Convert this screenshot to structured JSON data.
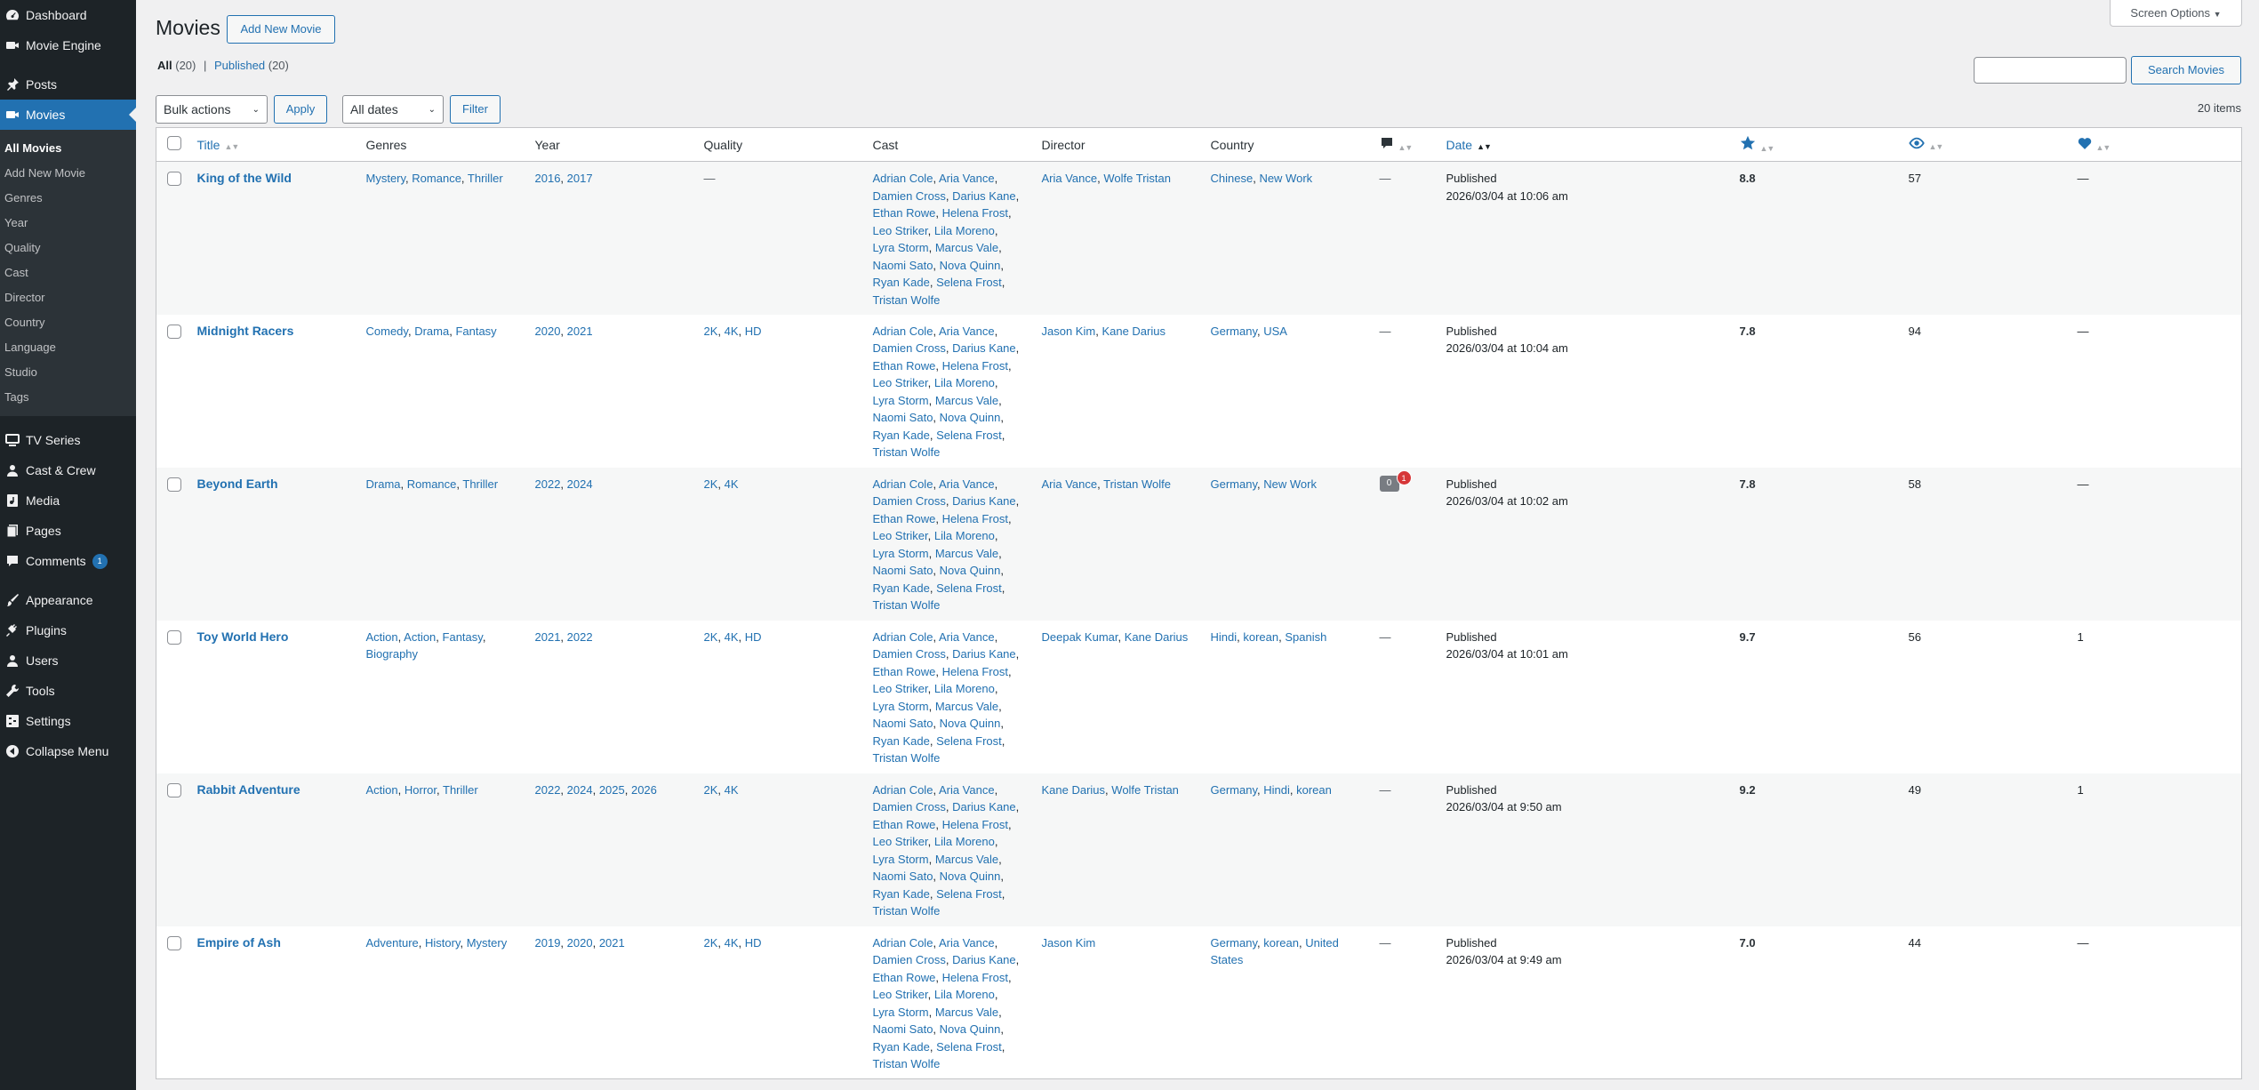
{
  "sidebar": {
    "top": [
      {
        "name": "dashboard",
        "label": "Dashboard",
        "icon": "dashboard-icon"
      },
      {
        "name": "movie-engine",
        "label": "Movie Engine",
        "icon": "video-icon"
      }
    ],
    "group2": [
      {
        "name": "posts",
        "label": "Posts",
        "icon": "pin-icon"
      },
      {
        "name": "movies",
        "label": "Movies",
        "icon": "video-icon",
        "current": true
      }
    ],
    "submenu": [
      "All Movies",
      "Add New Movie",
      "Genres",
      "Year",
      "Quality",
      "Cast",
      "Director",
      "Country",
      "Language",
      "Studio",
      "Tags"
    ],
    "group3": [
      {
        "name": "tv-series",
        "label": "TV Series",
        "icon": "tv-icon"
      },
      {
        "name": "cast-crew",
        "label": "Cast & Crew",
        "icon": "user-icon"
      },
      {
        "name": "media",
        "label": "Media",
        "icon": "media-icon"
      },
      {
        "name": "pages",
        "label": "Pages",
        "icon": "pages-icon"
      },
      {
        "name": "comments",
        "label": "Comments",
        "icon": "comment-icon",
        "badge": "1"
      }
    ],
    "group4": [
      {
        "name": "appearance",
        "label": "Appearance",
        "icon": "brush-icon"
      },
      {
        "name": "plugins",
        "label": "Plugins",
        "icon": "plug-icon"
      },
      {
        "name": "users",
        "label": "Users",
        "icon": "user-icon"
      },
      {
        "name": "tools",
        "label": "Tools",
        "icon": "wrench-icon"
      },
      {
        "name": "settings",
        "label": "Settings",
        "icon": "settings-icon"
      },
      {
        "name": "collapse",
        "label": "Collapse Menu",
        "icon": "collapse-icon"
      }
    ]
  },
  "header": {
    "title": "Movies",
    "add_new": "Add New Movie",
    "screen_options": "Screen Options",
    "search_button": "Search Movies",
    "search_value": ""
  },
  "views": {
    "all_label": "All",
    "all_count": "(20)",
    "sep": "|",
    "published_label": "Published",
    "published_count": "(20)"
  },
  "filters": {
    "bulk": "Bulk actions",
    "apply": "Apply",
    "dates": "All dates",
    "filter": "Filter",
    "items": "20 items"
  },
  "columns": {
    "title": "Title",
    "genres": "Genres",
    "year": "Year",
    "quality": "Quality",
    "cast": "Cast",
    "director": "Director",
    "country": "Country",
    "date": "Date"
  },
  "rows": [
    {
      "title": "King of the Wild",
      "genres": [
        "Mystery",
        "Romance",
        "Thriller"
      ],
      "years": [
        "2016",
        "2017"
      ],
      "quality": [],
      "director": [
        "Aria Vance",
        "Wolfe Tristan"
      ],
      "country": [
        "Chinese",
        "New Work"
      ],
      "comments": "—",
      "status": "Published",
      "date": "2026/03/04 at 10:06 am",
      "rating": "8.8",
      "views": "57",
      "likes": "—"
    },
    {
      "title": "Midnight Racers",
      "genres": [
        "Comedy",
        "Drama",
        "Fantasy"
      ],
      "years": [
        "2020",
        "2021"
      ],
      "quality": [
        "2K",
        "4K",
        "HD"
      ],
      "director": [
        "Jason Kim",
        "Kane Darius"
      ],
      "country": [
        "Germany",
        "USA"
      ],
      "comments": "—",
      "status": "Published",
      "date": "2026/03/04 at 10:04 am",
      "rating": "7.8",
      "views": "94",
      "likes": "—"
    },
    {
      "title": "Beyond Earth",
      "genres": [
        "Drama",
        "Romance",
        "Thriller"
      ],
      "years": [
        "2022",
        "2024"
      ],
      "quality": [
        "2K",
        "4K"
      ],
      "director": [
        "Aria Vance",
        "Tristan Wolfe"
      ],
      "country": [
        "Germany",
        "New Work"
      ],
      "comments": "bubble",
      "comments_approved": "0",
      "comments_pending": "1",
      "status": "Published",
      "date": "2026/03/04 at 10:02 am",
      "rating": "7.8",
      "views": "58",
      "likes": "—"
    },
    {
      "title": "Toy World Hero",
      "genres": [
        "Action",
        "Action",
        "Fantasy",
        "Biography"
      ],
      "years": [
        "2021",
        "2022"
      ],
      "quality": [
        "2K",
        "4K",
        "HD"
      ],
      "director": [
        "Deepak Kumar",
        "Kane Darius"
      ],
      "country": [
        "Hindi",
        "korean",
        "Spanish"
      ],
      "comments": "—",
      "status": "Published",
      "date": "2026/03/04 at 10:01 am",
      "rating": "9.7",
      "views": "56",
      "likes": "1"
    },
    {
      "title": "Rabbit Adventure",
      "genres": [
        "Action",
        "Horror",
        "Thriller"
      ],
      "years": [
        "2022",
        "2024",
        "2025",
        "2026"
      ],
      "quality": [
        "2K",
        "4K"
      ],
      "director": [
        "Kane Darius",
        "Wolfe Tristan"
      ],
      "country": [
        "Germany",
        "Hindi",
        "korean"
      ],
      "comments": "—",
      "status": "Published",
      "date": "2026/03/04 at 9:50 am",
      "rating": "9.2",
      "views": "49",
      "likes": "1"
    },
    {
      "title": "Empire of Ash",
      "genres": [
        "Adventure",
        "History",
        "Mystery"
      ],
      "years": [
        "2019",
        "2020",
        "2021"
      ],
      "quality": [
        "2K",
        "4K",
        "HD"
      ],
      "director": [
        "Jason Kim"
      ],
      "country": [
        "Germany",
        "korean",
        "United States"
      ],
      "comments": "—",
      "status": "Published",
      "date": "2026/03/04 at 9:49 am",
      "rating": "7.0",
      "views": "44",
      "likes": "—"
    }
  ],
  "cast_lines": [
    [
      "Adrian Cole",
      "Aria Vance"
    ],
    [
      "Damien Cross",
      "Darius Kane"
    ],
    [
      "Ethan Rowe",
      "Helena Frost"
    ],
    [
      "Leo Striker",
      "Lila Moreno"
    ],
    [
      "Lyra Storm",
      "Marcus Vale"
    ],
    [
      "Naomi Sato",
      "Nova Quinn"
    ],
    [
      "Ryan Kade",
      "Selena Frost"
    ],
    [
      "Tristan Wolfe"
    ]
  ],
  "empty_dash": "—",
  "colors": {
    "sidebar": "#1d2327",
    "accent": "#2271b1",
    "pending": "#d63638"
  }
}
